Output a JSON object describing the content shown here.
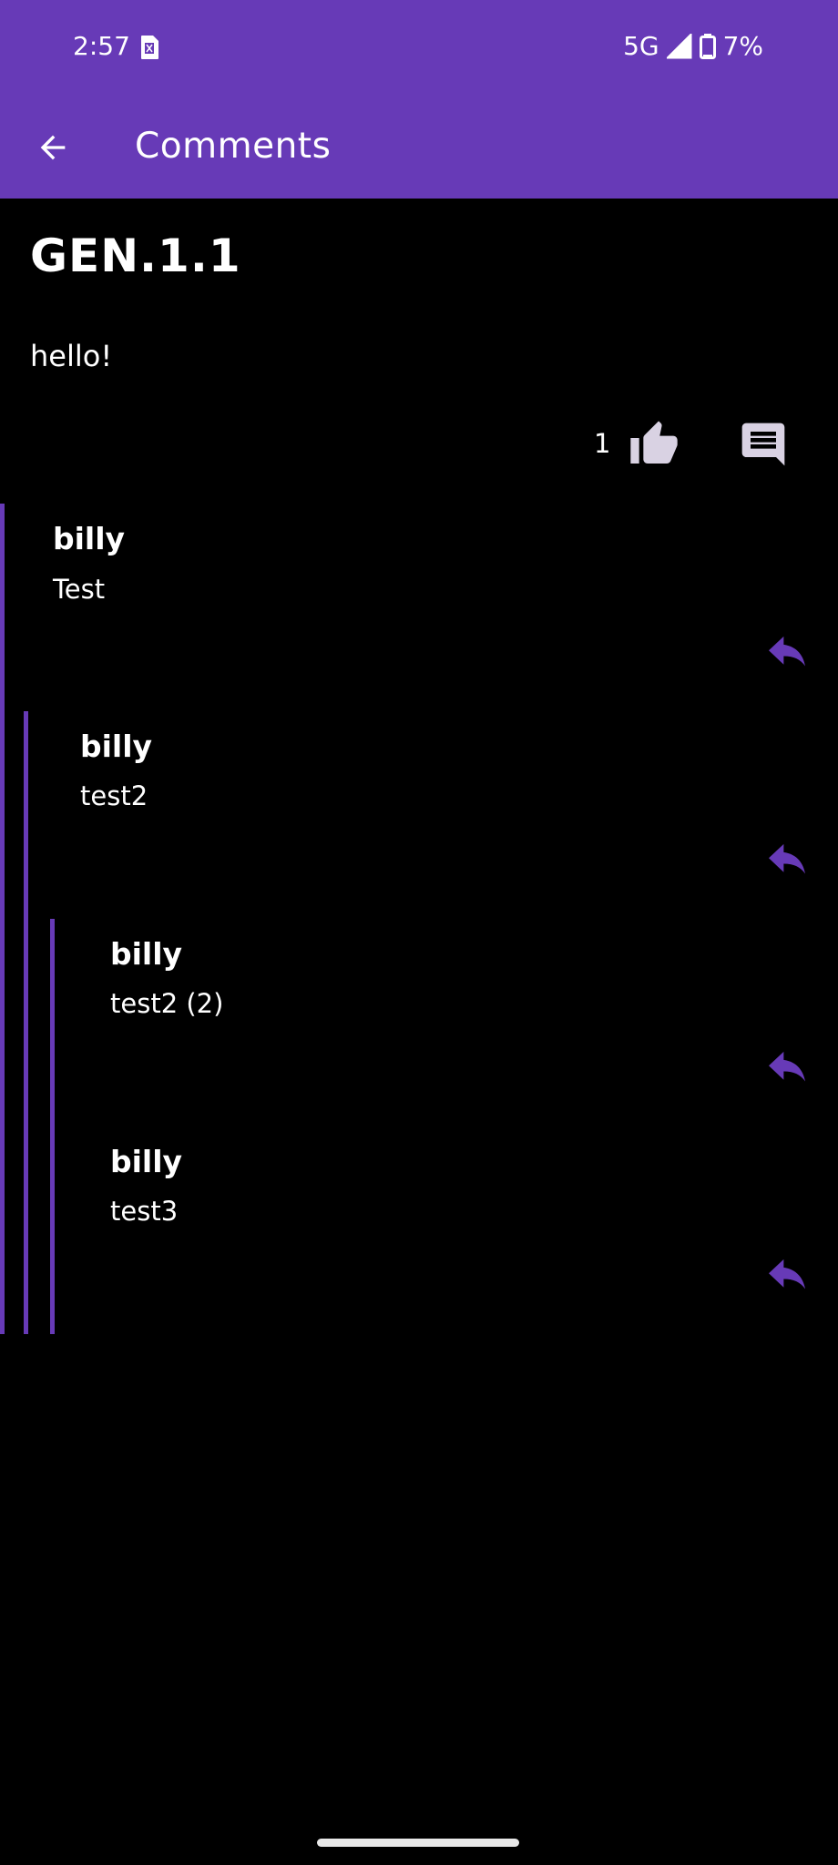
{
  "status_bar": {
    "time": "2:57",
    "network": "5G",
    "battery": "7%"
  },
  "app_bar": {
    "title": "Comments",
    "background": "#673ab7"
  },
  "post": {
    "title": "GEN.1.1",
    "body": "hello!",
    "like_count": "1"
  },
  "comments": [
    {
      "author": "billy",
      "text": "Test",
      "depth": 0
    },
    {
      "author": "billy",
      "text": "test2",
      "depth": 1
    },
    {
      "author": "billy",
      "text": "test2 (2)",
      "depth": 2
    },
    {
      "author": "billy",
      "text": "test3",
      "depth": 2
    }
  ],
  "icons": {
    "back": "arrow-back-icon",
    "like": "thumb-up-icon",
    "comment": "comment-icon",
    "reply": "reply-icon",
    "sim": "sim-card-icon",
    "signal": "signal-icon",
    "battery": "battery-icon"
  },
  "colors": {
    "accent": "#673ab7",
    "icon_grey": "#d9d2e3",
    "background": "#000000"
  }
}
